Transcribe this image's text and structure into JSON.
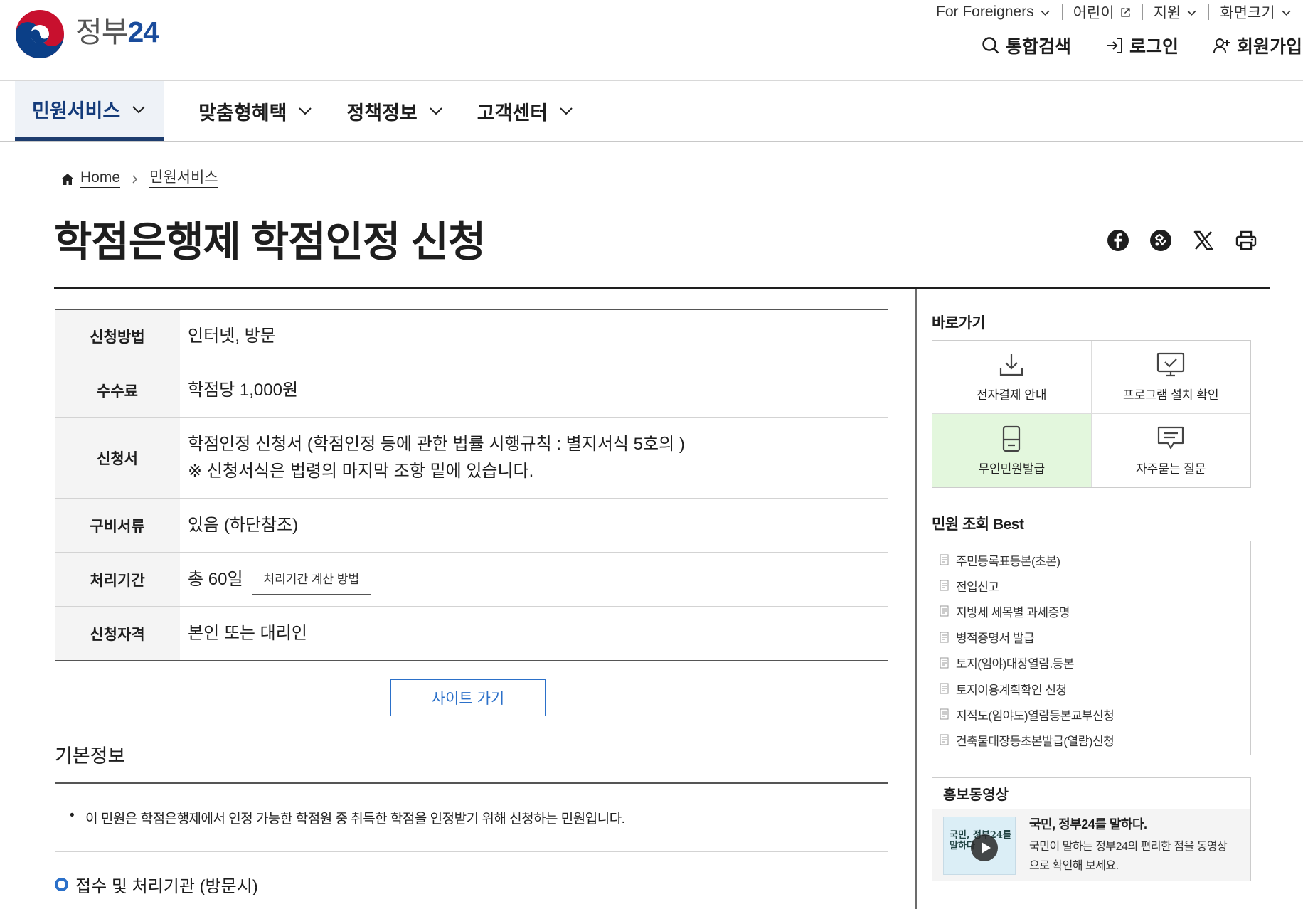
{
  "header": {
    "logo_text": "정부",
    "logo_num": "24",
    "util": [
      {
        "label": "For Foreigners",
        "icon": "chevron-down-icon"
      },
      {
        "label": "어린이",
        "icon": "external-link-icon"
      },
      {
        "label": "지원",
        "icon": "chevron-down-icon"
      },
      {
        "label": "화면크기",
        "icon": "chevron-down-icon"
      }
    ],
    "actions": [
      {
        "label": "통합검색",
        "icon": "search-icon"
      },
      {
        "label": "로그인",
        "icon": "login-icon"
      },
      {
        "label": "회원가입",
        "icon": "user-plus-icon"
      }
    ]
  },
  "gnb": [
    {
      "label": "민원서비스",
      "active": true
    },
    {
      "label": "맞춤형혜택"
    },
    {
      "label": "정책정보"
    },
    {
      "label": "고객센터"
    }
  ],
  "breadcrumb": {
    "home": "Home",
    "current": "민원서비스"
  },
  "page_title": "학점은행제 학점인정 신청",
  "share": [
    "facebook-icon",
    "copy-link-icon",
    "x-twitter-icon",
    "print-icon"
  ],
  "info": {
    "method_label": "신청방법",
    "method_value": "인터넷, 방문",
    "fee_label": "수수료",
    "fee_value": "학점당 1,000원",
    "form_label": "신청서",
    "form_value_1": "학점인정 신청서 (학점인정 등에 관한 법률 시행규칙 : 별지서식 5호의 )",
    "form_value_2": "※ 신청서식은 법령의 마지막 조항 밑에 있습니다.",
    "docs_label": "구비서류",
    "docs_value": "있음 (하단참조)",
    "period_label": "처리기간",
    "period_value": "총 60일",
    "period_button": "처리기간 계산 방법",
    "eligibility_label": "신청자격",
    "eligibility_value": "본인 또는 대리인"
  },
  "site_button": "사이트 가기",
  "basic": {
    "title": "기본정보",
    "item": "이 민원은 학점은행제에서 인정 가능한 학점원 중 취득한 학점을 인정받기 위해 신청하는 민원입니다."
  },
  "agency_title": "접수 및 처리기관 (방문시)",
  "sidebar": {
    "quick_title": "바로가기",
    "quick": [
      {
        "label": "전자결제 안내",
        "icon": "download-icon"
      },
      {
        "label": "프로그램 설치 확인",
        "icon": "monitor-check-icon"
      },
      {
        "label": "무인민원발급",
        "icon": "kiosk-icon",
        "highlighted": true
      },
      {
        "label": "자주묻는 질문",
        "icon": "faq-chat-icon"
      }
    ],
    "best_title": "민원 조회 Best",
    "best": [
      "주민등록표등본(초본)",
      "전입신고",
      "지방세 세목별 과세증명",
      "병적증명서 발급",
      "토지(임야)대장열람.등본",
      "토지이용계획확인 신청",
      "지적도(임야도)열람등본교부신청",
      "건축물대장등초본발급(열람)신청"
    ],
    "promo_title": "홍보동영상",
    "promo_heading": "국민, 정부24를 말하다.",
    "promo_desc": "국민이 말하는 정부24의 편리한 점을 동영상으로 확인해 보세요.",
    "promo_thumb_caption": "국민, 정부24를 말하다"
  },
  "colors": {
    "brand_navy": "#1d3c6e",
    "accent_blue": "#2b70c9",
    "highlight_green": "#e3f7dd"
  }
}
